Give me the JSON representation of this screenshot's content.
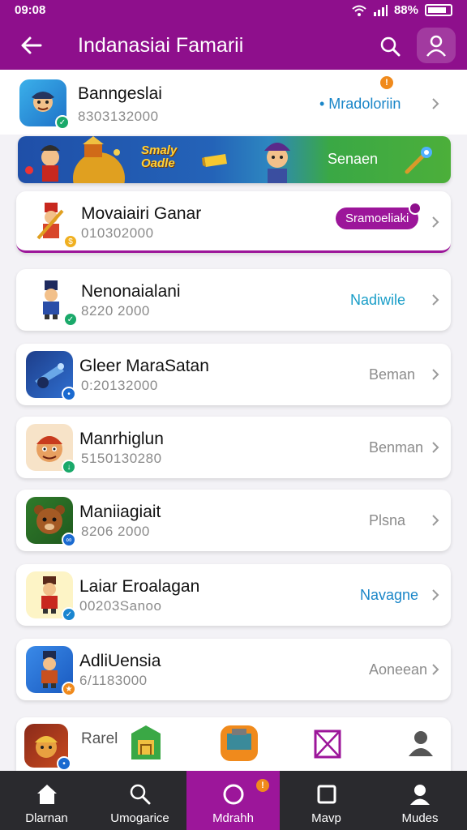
{
  "status": {
    "time": "09:08",
    "battery": "88%"
  },
  "header": {
    "title": "Indanasiai Famarii"
  },
  "apps": [
    {
      "name": "Banngeslai",
      "sub": "8303132000",
      "action": "• Mradoloriin",
      "action_color": "#1a86c8",
      "notif": "!"
    },
    {
      "name": "Movaiairi Ganar",
      "sub": "010302000",
      "pill": "Sramoeliaki"
    },
    {
      "name": "Nenonaialani",
      "sub": "8220 2000",
      "action": "Nadiwile",
      "action_color": "#1a9ec8"
    },
    {
      "name": "Gleer MaraSatan",
      "sub": "0:20132000",
      "action": "Beman",
      "action_color": "#8c8c8c"
    },
    {
      "name": "Manrhiglun",
      "sub": "5150130280",
      "action": "Benman",
      "action_color": "#8c8c8c"
    },
    {
      "name": "Maniiagiait",
      "sub": "8206 2000",
      "action": "Plsna",
      "action_color": "#8c8c8c"
    },
    {
      "name": "Laiar Eroalagan",
      "sub": "00203Sanoo",
      "action": "Navagne",
      "action_color": "#1a86c8"
    },
    {
      "name": "AdliUensia",
      "sub": "6/1183000",
      "action": "Aoneean",
      "action_color": "#8c8c8c"
    }
  ],
  "banner": {
    "logo_line1": "Smaly",
    "logo_line2": "Oadle",
    "cta": "Senaen"
  },
  "dock": {
    "label": "Rarel"
  },
  "nav": [
    {
      "label": "Dlarnan",
      "icon": "home-icon"
    },
    {
      "label": "Umogarice",
      "icon": "search-icon"
    },
    {
      "label": "Mdrahh",
      "icon": "circle-icon",
      "badge": "!"
    },
    {
      "label": "Mavp",
      "icon": "square-icon"
    },
    {
      "label": "Mudes",
      "icon": "person-icon"
    }
  ],
  "colors": {
    "accent": "#9c169a",
    "header": "#8e0f8c",
    "nav_bg": "#2a2a2e"
  }
}
